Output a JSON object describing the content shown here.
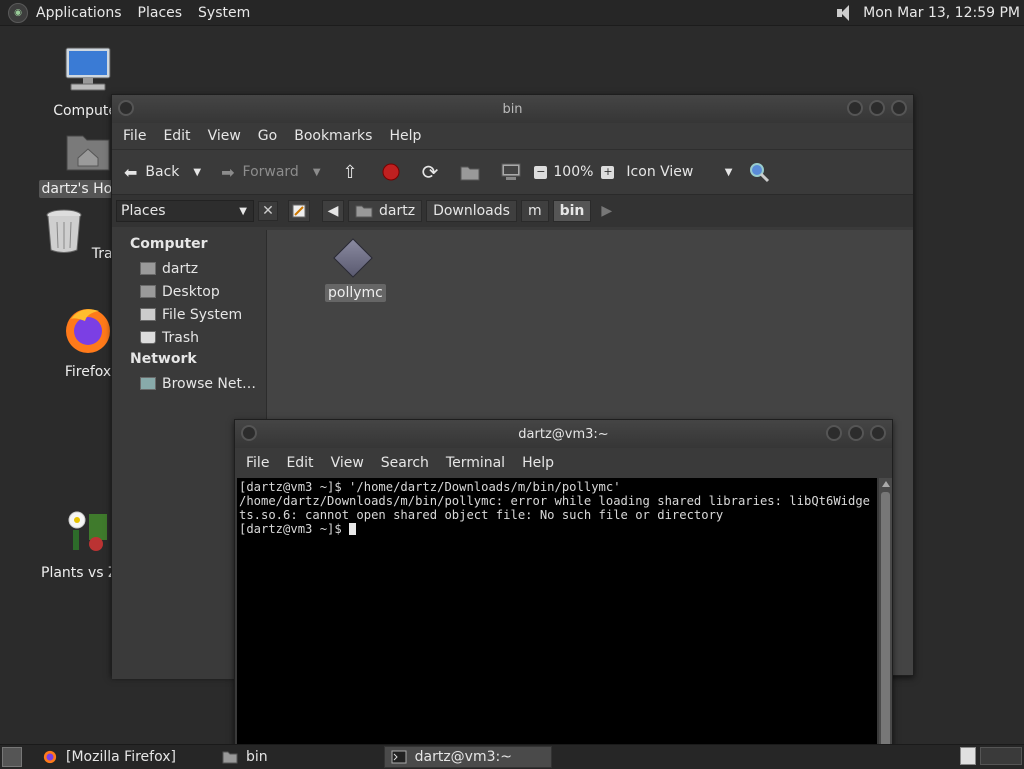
{
  "top_panel": {
    "menus": [
      "Applications",
      "Places",
      "System"
    ],
    "clock": "Mon Mar 13, 12:59 PM"
  },
  "desktop": {
    "icons": [
      {
        "label": "Computer"
      },
      {
        "label": "dartz's Home"
      },
      {
        "label": "Trash"
      },
      {
        "label": "Firefox"
      },
      {
        "label": "Plants vs Zombies"
      }
    ]
  },
  "file_manager": {
    "title": "bin",
    "menus": [
      "File",
      "Edit",
      "View",
      "Go",
      "Bookmarks",
      "Help"
    ],
    "toolbar": {
      "back": "Back",
      "forward": "Forward",
      "zoom": "100%",
      "view_mode": "Icon View"
    },
    "places_label": "Places",
    "breadcrumbs": [
      "dartz",
      "Downloads",
      "m",
      "bin"
    ],
    "sidebar": {
      "computer_header": "Computer",
      "computer_items": [
        "dartz",
        "Desktop",
        "File System",
        "Trash"
      ],
      "network_header": "Network",
      "network_items": [
        "Browse Net…"
      ]
    },
    "files": [
      {
        "name": "pollymc"
      }
    ]
  },
  "terminal": {
    "title": "dartz@vm3:~",
    "menus": [
      "File",
      "Edit",
      "View",
      "Search",
      "Terminal",
      "Help"
    ],
    "lines": [
      "[dartz@vm3 ~]$ '/home/dartz/Downloads/m/bin/pollymc'",
      "/home/dartz/Downloads/m/bin/pollymc: error while loading shared libraries: libQt6Widgets.so.6: cannot open shared object file: No such file or directory",
      "[dartz@vm3 ~]$ "
    ]
  },
  "taskbar": {
    "tasks": [
      "[Mozilla Firefox]",
      "bin",
      "dartz@vm3:~"
    ]
  }
}
